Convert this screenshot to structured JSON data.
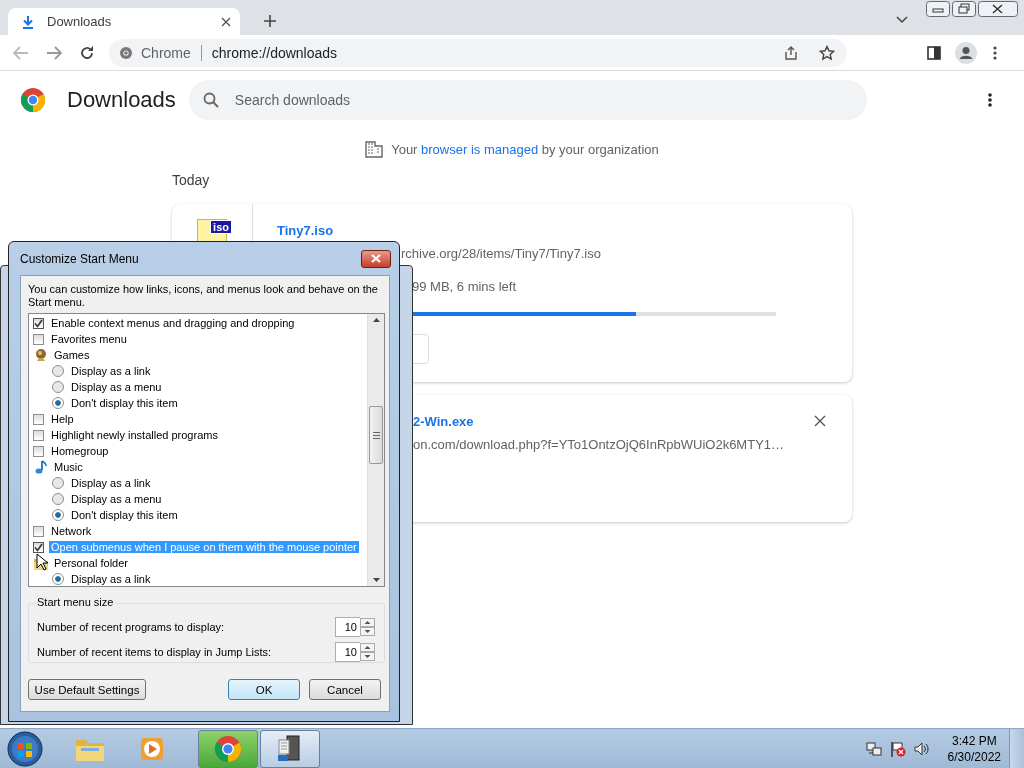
{
  "browser": {
    "tab": {
      "title": "Downloads",
      "selected": true
    },
    "address": {
      "site_label": "Chrome",
      "url": "chrome://downloads"
    }
  },
  "downloads_page": {
    "title": "Downloads",
    "search": {
      "placeholder": "Search downloads"
    },
    "managed_notice": {
      "before": "Your",
      "link": "browser is managed",
      "after": "by your organization"
    },
    "date_heading": "Today",
    "items": [
      {
        "name": "Tiny7.iso",
        "icon_label": "iso",
        "url": "rchive.org/28/items/Tiny7/Tiny7.iso",
        "status": "99 MB, 6 mins left",
        "level": 0.72
      },
      {
        "name": "2-Win.exe",
        "url": "on.com/download.php?f=YTo1OntzOjQ6InRpbWUiO2k6MTY1…"
      }
    ]
  },
  "dialog": {
    "title": "Customize Start Menu",
    "description": "You can customize how links, icons, and menus look and behave on the Start menu.",
    "options": [
      {
        "kind": "checkbox",
        "label": "Enable context menus and dragging and dropping",
        "checked": true,
        "selected": false
      },
      {
        "kind": "checkbox",
        "label": "Favorites menu",
        "checked": false,
        "selected": false
      },
      {
        "kind": "group",
        "label": "Games",
        "selected": false
      },
      {
        "kind": "radio",
        "label": "Display as a link",
        "checked": false,
        "selected": false
      },
      {
        "kind": "radio",
        "label": "Display as a menu",
        "checked": false,
        "selected": false
      },
      {
        "kind": "radio",
        "label": "Don't display this item",
        "checked": true,
        "selected": false
      },
      {
        "kind": "checkbox",
        "label": "Help",
        "checked": false,
        "selected": false
      },
      {
        "kind": "checkbox",
        "label": "Highlight newly installed programs",
        "checked": false,
        "selected": false
      },
      {
        "kind": "checkbox",
        "label": "Homegroup",
        "checked": false,
        "selected": false
      },
      {
        "kind": "group",
        "label": "Music",
        "selected": false
      },
      {
        "kind": "radio",
        "label": "Display as a link",
        "checked": false,
        "selected": false
      },
      {
        "kind": "radio",
        "label": "Display as a menu",
        "checked": false,
        "selected": false
      },
      {
        "kind": "radio",
        "label": "Don't display this item",
        "checked": true,
        "selected": false
      },
      {
        "kind": "checkbox",
        "label": "Network",
        "checked": false,
        "selected": false
      },
      {
        "kind": "checkbox",
        "label": "Open submenus when I pause on them with the mouse pointer",
        "checked": true,
        "selected": true
      },
      {
        "kind": "group",
        "label": "Personal folder",
        "selected": false
      },
      {
        "kind": "radio",
        "label": "Display as a link",
        "checked": true,
        "selected": false
      }
    ],
    "size_group": {
      "title": "Start menu size",
      "fields": [
        {
          "label": "Number of recent programs to display:",
          "value": "10"
        },
        {
          "label": "Number of recent items to display in Jump Lists:",
          "value": "10"
        }
      ]
    },
    "buttons": [
      {
        "label": "Use Default Settings",
        "default": false
      },
      {
        "label": "OK",
        "default": true
      },
      {
        "label": "Cancel",
        "default": false
      }
    ]
  },
  "taskbar": {
    "time": "3:42 PM",
    "date": "6/30/2022"
  }
}
